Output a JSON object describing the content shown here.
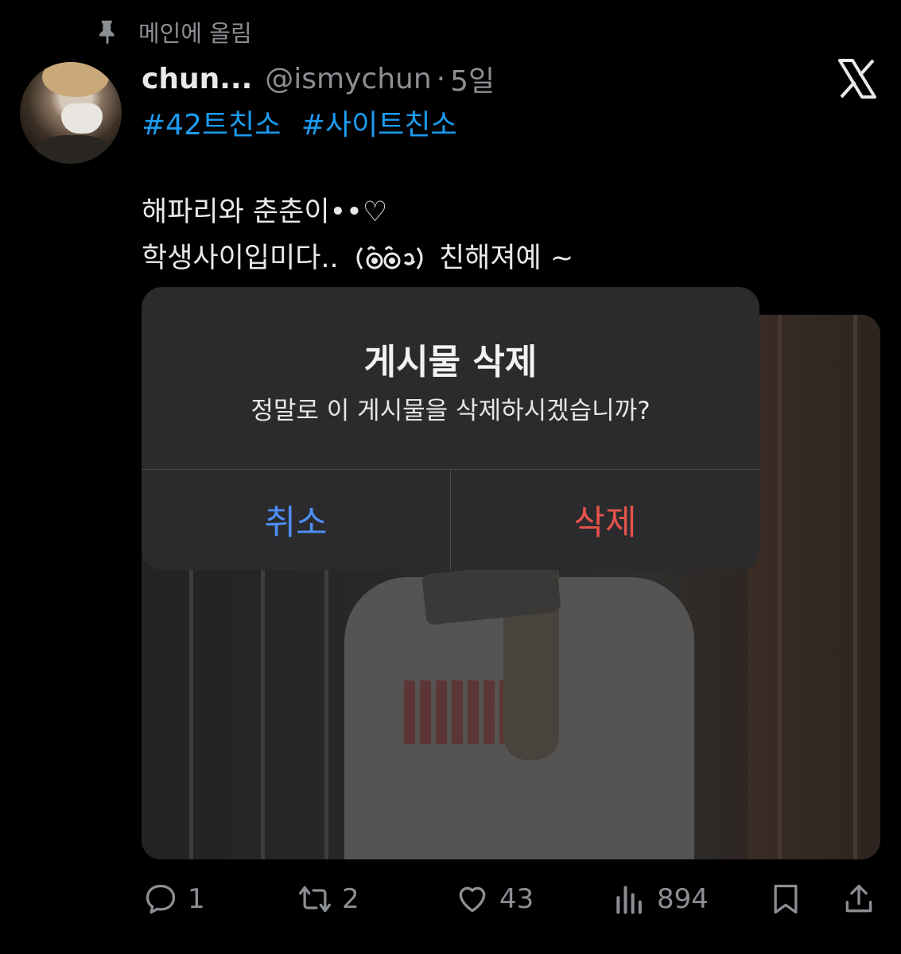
{
  "pinned": {
    "label": "메인에 올림",
    "icon": "pin-icon"
  },
  "tweet": {
    "display_name": "chun...",
    "handle": "@ismychun",
    "separator": "·",
    "time": "5일",
    "hashtags": [
      "#42트친소",
      "#사이트친소"
    ],
    "lines": [
      "해파리와 춘춘이••♡",
      "학생사이입미다.. ᕙ(͡°‿ ͡°)ᕗ 친해져예 ~"
    ],
    "line2_parts": {
      "before": "학생사이입미다..",
      "after": "친해져예 ~"
    }
  },
  "alert": {
    "title": "게시물 삭제",
    "message": "정말로 이 게시물을 삭제하시겠습니까?",
    "cancel_label": "취소",
    "delete_label": "삭제"
  },
  "actions": {
    "reply_count": "1",
    "retweet_count": "2",
    "like_count": "43",
    "view_count": "894"
  },
  "colors": {
    "background": "#000000",
    "accent_blue": "#1d9bf0",
    "cancel_blue": "#4e8ef7",
    "delete_red": "#e5534b",
    "muted": "#8b8e93"
  }
}
